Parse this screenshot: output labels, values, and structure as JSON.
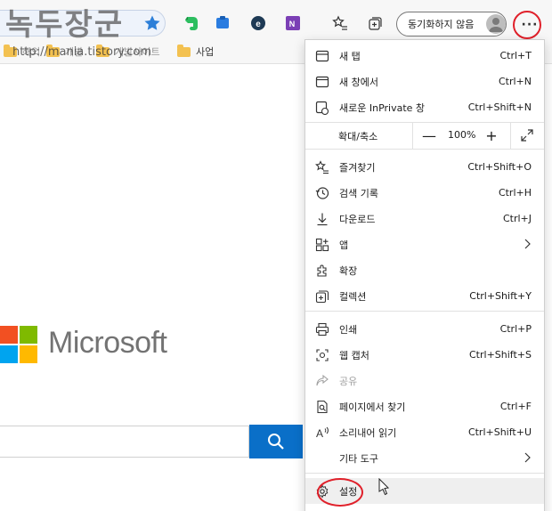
{
  "watermark": {
    "title": "녹두장군",
    "url": "http://mania.tistory.com"
  },
  "toolbar": {
    "favorite_star": "star-icon",
    "extensions": [
      "evernote-icon",
      "edge-ext-icon",
      "e-icon",
      "onenote-icon"
    ],
    "sync_label": "동기화하지 않음",
    "more_label": "···"
  },
  "bookmarks": [
    {
      "label": "해외"
    },
    {
      "label": "개발"
    },
    {
      "label": "개발사이트"
    },
    {
      "label": "사업"
    }
  ],
  "page": {
    "brand": "Microsoft"
  },
  "menu": {
    "items": [
      {
        "label": "새 탭",
        "shortcut": "Ctrl+T",
        "icon": "new-tab-icon"
      },
      {
        "label": "새 창에서",
        "shortcut": "Ctrl+N",
        "icon": "new-window-icon"
      },
      {
        "label": "새로운 InPrivate 창",
        "shortcut": "Ctrl+Shift+N",
        "icon": "inprivate-icon"
      },
      {
        "label": "즐겨찾기",
        "shortcut": "Ctrl+Shift+O",
        "icon": "favorites-icon"
      },
      {
        "label": "검색 기록",
        "shortcut": "Ctrl+H",
        "icon": "history-icon"
      },
      {
        "label": "다운로드",
        "shortcut": "Ctrl+J",
        "icon": "download-icon"
      },
      {
        "label": "앱",
        "shortcut": "",
        "icon": "apps-icon"
      },
      {
        "label": "확장",
        "shortcut": "",
        "icon": "extensions-icon"
      },
      {
        "label": "컬렉션",
        "shortcut": "Ctrl+Shift+Y",
        "icon": "collections-icon"
      },
      {
        "label": "인쇄",
        "shortcut": "Ctrl+P",
        "icon": "print-icon"
      },
      {
        "label": "웹 캡처",
        "shortcut": "Ctrl+Shift+S",
        "icon": "web-capture-icon"
      },
      {
        "label": "공유",
        "shortcut": "",
        "icon": "share-icon"
      },
      {
        "label": "페이지에서 찾기",
        "shortcut": "Ctrl+F",
        "icon": "find-icon"
      },
      {
        "label": "소리내어 읽기",
        "shortcut": "Ctrl+Shift+U",
        "icon": "read-aloud-icon"
      },
      {
        "label": "기타 도구",
        "shortcut": "",
        "icon": ""
      },
      {
        "label": "설정",
        "shortcut": "",
        "icon": "settings-icon"
      }
    ],
    "zoom": {
      "label": "확대/축소",
      "minus": "—",
      "value": "100%",
      "plus": "+"
    }
  },
  "colors": {
    "accent": "#0a6fc8",
    "highlight": "#e0202a"
  }
}
